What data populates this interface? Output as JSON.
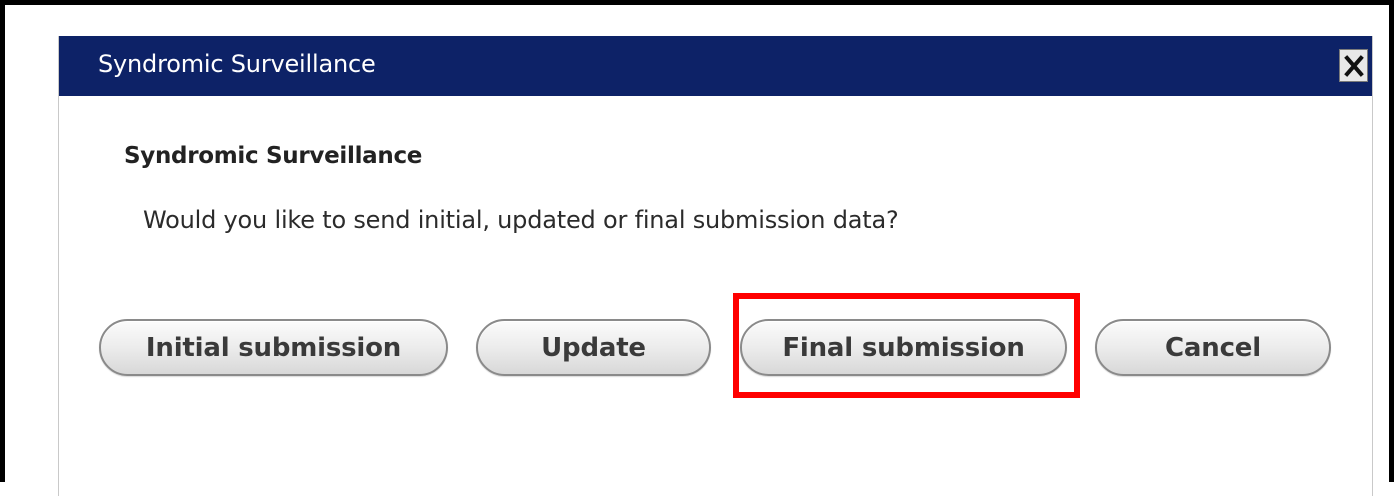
{
  "dialog": {
    "title": "Syndromic Surveillance",
    "close_icon": "close-icon",
    "heading": "Syndromic Surveillance",
    "question": "Would you like to send initial, updated or final submission data?"
  },
  "buttons": {
    "initial_label": "Initial submission",
    "update_label": "Update",
    "final_label": "Final submission",
    "cancel_label": "Cancel"
  },
  "colors": {
    "title_bar": "#0d2267",
    "highlight": "#ff0000"
  },
  "annotation": {
    "highlighted_button": "Final submission"
  }
}
